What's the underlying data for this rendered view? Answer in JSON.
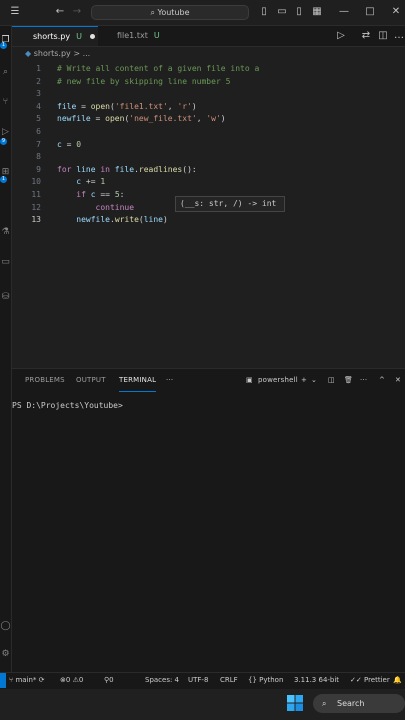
{
  "titlebar": {
    "search_text": "Youtube"
  },
  "tabs": [
    {
      "label": "shorts.py",
      "status": "U",
      "modified": true
    },
    {
      "label": "file1.txt",
      "status": "U"
    }
  ],
  "breadcrumb": {
    "file": "shorts.py",
    "more": "> ..."
  },
  "editor": {
    "line_numbers": [
      "1",
      "2",
      "3",
      "4",
      "5",
      "6",
      "7",
      "8",
      "9",
      "10",
      "11",
      "12",
      "13"
    ],
    "current_line": "13",
    "hover_signature": "(__s: str, /) -> int"
  },
  "panel": {
    "tabs": [
      "PROBLEMS",
      "OUTPUT",
      "TERMINAL"
    ],
    "more": "···",
    "shell_label": "powershell",
    "terminal_prompt": "PS D:\\Projects\\Youtube>"
  },
  "statusbar": {
    "branch": "main*",
    "errors": "0",
    "warnings": "0",
    "ports": "0",
    "spaces": "Spaces: 4",
    "encoding": "UTF-8",
    "eol": "CRLF",
    "language": "Python",
    "interpreter": "3.11.3 64-bit",
    "prettier": "Prettier"
  },
  "taskbar": {
    "search_label": "Search"
  },
  "colors": {
    "accent": "#0078d4",
    "background": "#1f1f1f",
    "comment": "#6a9955",
    "keyword": "#c586c0",
    "string": "#ce9178"
  }
}
